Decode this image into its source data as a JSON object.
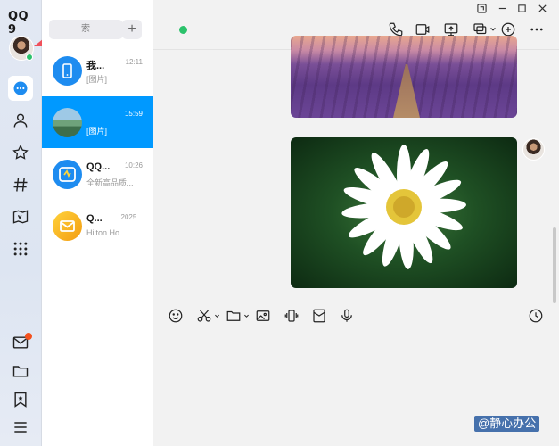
{
  "app": {
    "logo": "QQ 9"
  },
  "search": {
    "placeholder": "索"
  },
  "conversations": [
    {
      "name": "我...",
      "time": "12:11",
      "preview": "[图片]",
      "color": "#1e8cf0",
      "icon": "phone-device-icon"
    },
    {
      "name": "",
      "time": "15:59",
      "preview": "[图片]",
      "color": "#5fa3c8",
      "icon": "landscape-avatar",
      "selected": true
    },
    {
      "name": "QQ...",
      "time": "10:26",
      "preview": "全新高品质...",
      "color": "#1e8cf0",
      "icon": "qq-service-icon"
    },
    {
      "name": "Q...",
      "time": "2025...",
      "preview": "Hilton Ho...",
      "color": "#f5b21f",
      "icon": "mail-icon"
    }
  ],
  "colors": {
    "accent": "#0099ff",
    "online": "#2bc26b",
    "alert": "#f4511e"
  },
  "watermark": "@静心办公"
}
